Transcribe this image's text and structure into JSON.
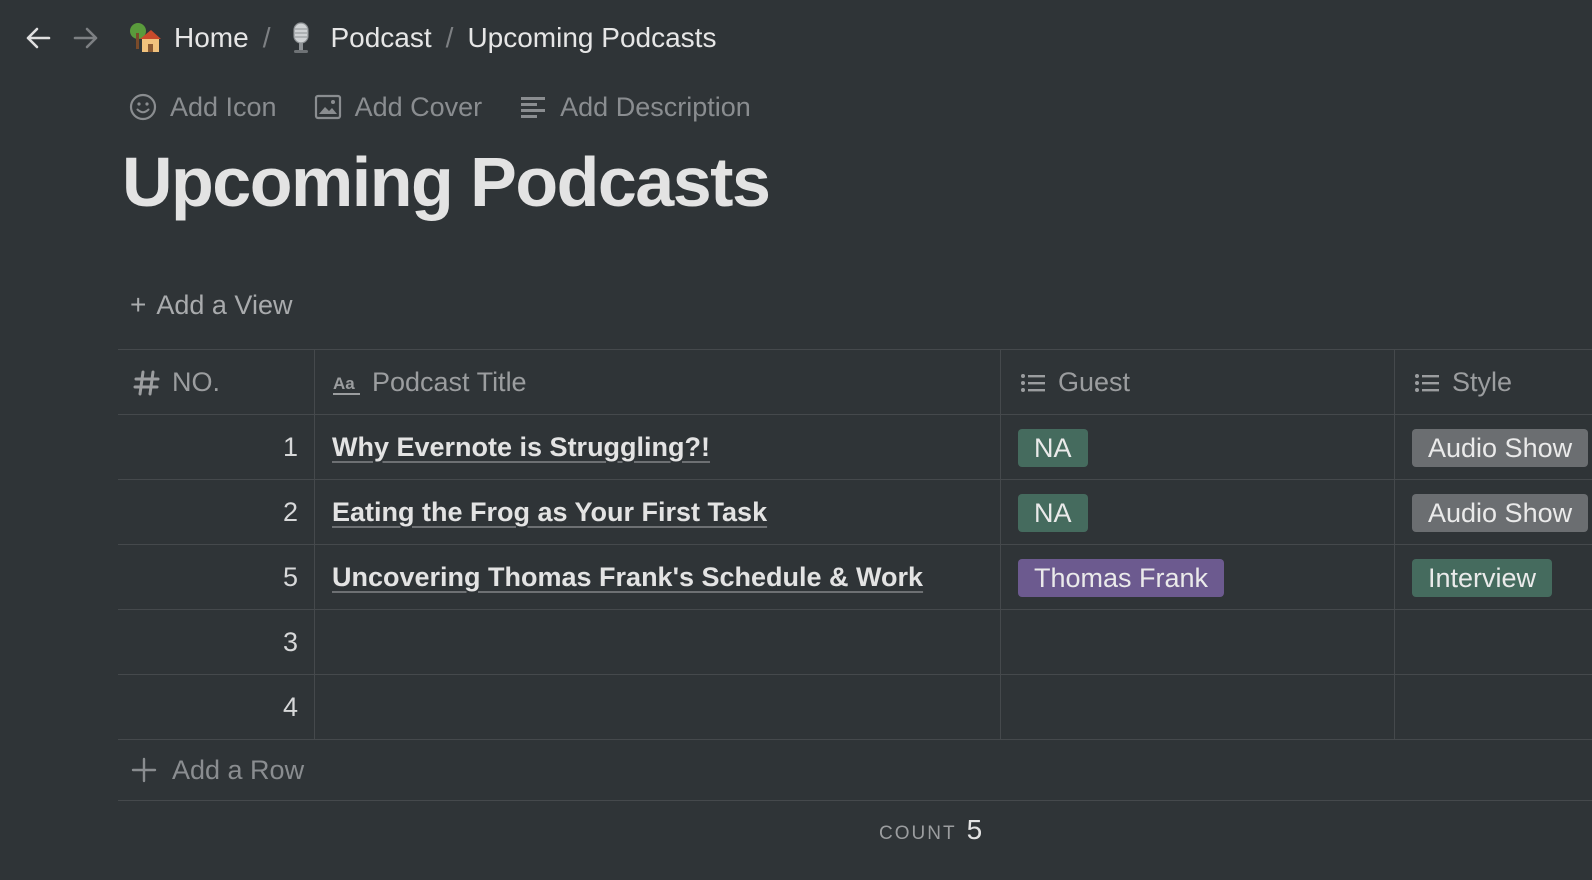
{
  "nav": {
    "back_icon": "arrow-left-icon",
    "forward_icon": "arrow-right-icon"
  },
  "breadcrumb": [
    {
      "label": "Home",
      "icon": "house-emoji-icon"
    },
    {
      "label": "Podcast",
      "icon": "microphone-emoji-icon"
    },
    {
      "label": "Upcoming Podcasts"
    }
  ],
  "breadcrumb_separator": "/",
  "page_actions": {
    "add_icon": "Add Icon",
    "add_cover": "Add Cover",
    "add_description": "Add Description"
  },
  "page_title": "Upcoming Podcasts",
  "add_view": {
    "plus": "+",
    "label": "Add a View"
  },
  "table": {
    "columns": [
      {
        "label": "NO.",
        "icon": "number-icon"
      },
      {
        "label": "Podcast Title",
        "icon": "text-icon"
      },
      {
        "label": "Guest",
        "icon": "list-icon"
      },
      {
        "label": "Style",
        "icon": "list-icon"
      }
    ],
    "rows": [
      {
        "no": "1",
        "title": "Why Evernote is Struggling?!",
        "guest": "NA",
        "style": "Audio Show"
      },
      {
        "no": "2",
        "title": "Eating the Frog as Your First Task",
        "guest": "NA",
        "style": "Audio Show"
      },
      {
        "no": "5",
        "title": "Uncovering Thomas Frank's Schedule & Work",
        "guest": "Thomas Frank",
        "style": "Interview"
      },
      {
        "no": "3",
        "title": "",
        "guest": "",
        "style": ""
      },
      {
        "no": "4",
        "title": "",
        "guest": "",
        "style": ""
      }
    ],
    "add_row_label": "Add a Row"
  },
  "tag_colors": {
    "NA": "#456b5e",
    "Thomas Frank": "#6c5a8f",
    "Audio Show": "#6b6e71",
    "Interview": "#456b5e"
  },
  "footer": {
    "count_label": "COUNT",
    "count_value": "5"
  }
}
